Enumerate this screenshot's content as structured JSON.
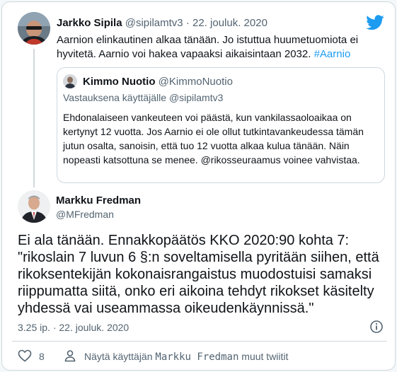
{
  "parent_tweet": {
    "name": "Jarkko Sipila",
    "handle": "@sipilamtv3",
    "separator": "·",
    "date": "22. jouluk. 2020",
    "text": "Aarnion elinkautinen alkaa tänään. Jo istuttua huumetuomiota ei hyvitetä. Aarnio voi hakea vapaaksi aikaisintaan 2032.",
    "hashtag": "#Aarnio"
  },
  "quoted_tweet": {
    "name": "Kimmo Nuotio",
    "handle": "@KimmoNuotio",
    "reply_to": "Vastauksena käyttäjälle @sipilamtv3",
    "text": "Ehdonalaiseen vankeuteen voi päästä, kun vankilassaoloaikaa on kertynyt 12 vuotta. Jos Aarnio ei ole ollut tutkintavankeudessa tämän jutun osalta, sanoisin, että tuo 12 vuotta alkaa kulua tänään. Näin nopeasti katsottuna se menee. @rikosseuraamus voinee vahvistaa."
  },
  "main_tweet": {
    "name": "Markku Fredman",
    "handle": "@MFredman",
    "text": "Ei ala tänään. Ennakkopäätös KKO 2020:90 kohta 7:  \"rikoslain 7 luvun 6 §:n soveltamisella pyritään siihen, että rikoksentekijän kokonaisrangaistus muodostuisi samaksi riippumatta siitä, onko eri aikoina tehdyt rikokset käsitelty yhdessä vai useammassa oikeudenkäynnissä.\"",
    "timestamp": "3.25 ip. · 22. jouluk. 2020",
    "like_count": "8",
    "more_prefix": "Näytä käyttäjän",
    "more_name": "Markku Fredman",
    "more_suffix": "muut twiitit"
  },
  "colors": {
    "accent": "#1d9bf0",
    "text": "#0f1419",
    "muted": "#536471",
    "border": "#cfd9de"
  },
  "icons": [
    "twitter-bird-icon",
    "info-icon",
    "heart-icon",
    "person-icon"
  ]
}
